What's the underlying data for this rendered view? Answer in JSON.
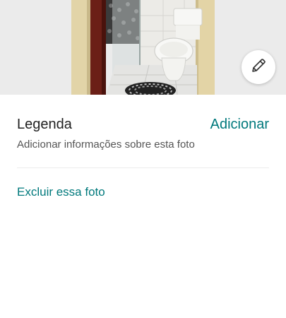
{
  "photo": {
    "subject": "bathroom-photo",
    "edit_icon": "pencil-icon"
  },
  "caption": {
    "title": "Legenda",
    "add_label": "Adicionar",
    "description": "Adicionar informações sobre esta foto"
  },
  "actions": {
    "delete_label": "Excluir essa foto"
  },
  "colors": {
    "accent": "#00797c",
    "text_primary": "#222222",
    "text_secondary": "#555555",
    "divider": "#ebebeb"
  }
}
